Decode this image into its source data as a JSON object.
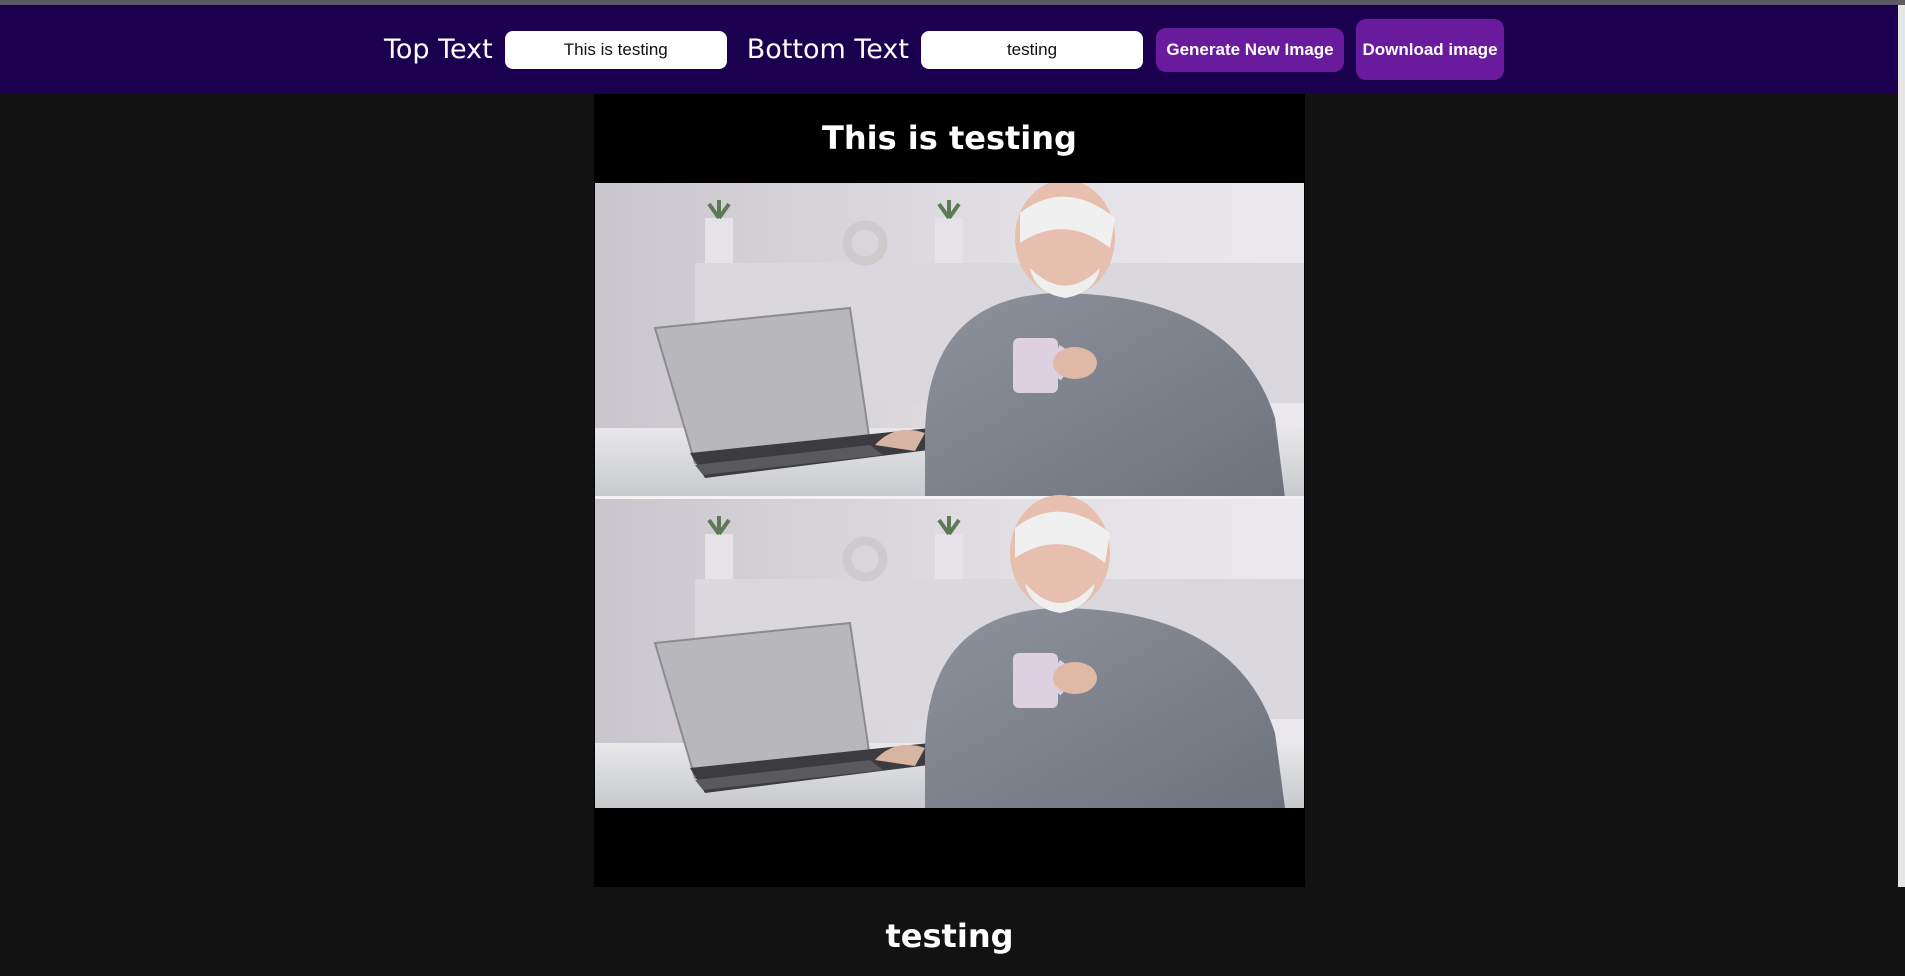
{
  "controls": {
    "top_text_label": "Top Text",
    "top_text_value": "This is testing",
    "bottom_text_label": "Bottom Text",
    "bottom_text_value": "testing",
    "generate_button": "Generate New Image",
    "download_button": "Download image"
  },
  "meme": {
    "top_caption": "This is testing",
    "bottom_caption": "testing",
    "image_icon": "meme-image-two-panel"
  },
  "colors": {
    "header_bg": "#1c0050",
    "button_bg": "#6a1a9c",
    "page_bg": "#121212",
    "meme_bg": "#000000"
  }
}
